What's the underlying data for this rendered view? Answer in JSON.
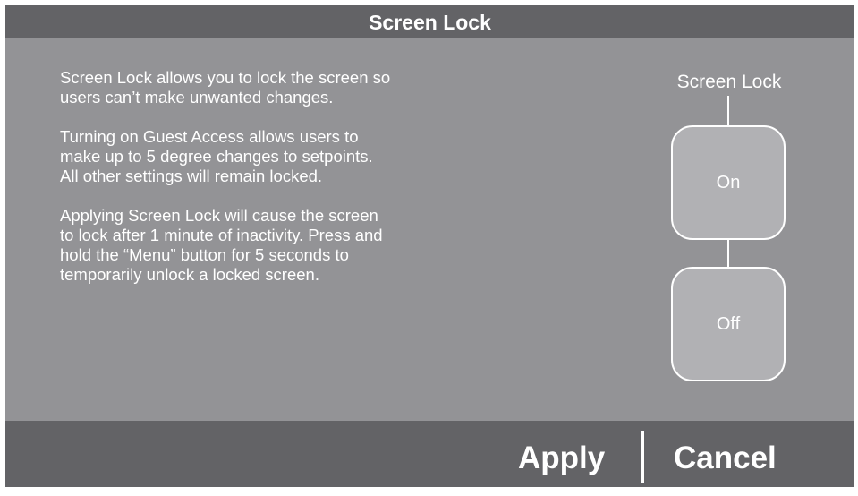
{
  "title": "Screen Lock",
  "description": [
    "Screen Lock allows you to lock the screen so users can’t make unwanted changes.",
    "Turning on Guest Access allows users to make up to 5 degree changes to setpoints. All other settings will remain locked.",
    "Applying Screen Lock will cause the screen to lock after 1 minute of inactivity. Press and hold the “Menu” button for 5 seconds to temporarily unlock a locked screen."
  ],
  "option_group": {
    "label": "Screen Lock",
    "options": [
      "On",
      "Off"
    ]
  },
  "actions": {
    "apply": "Apply",
    "cancel": "Cancel"
  },
  "colors": {
    "background": "#939396",
    "bars": "#636366",
    "option_fill": "#b1b1b4",
    "text": "#ffffff"
  }
}
